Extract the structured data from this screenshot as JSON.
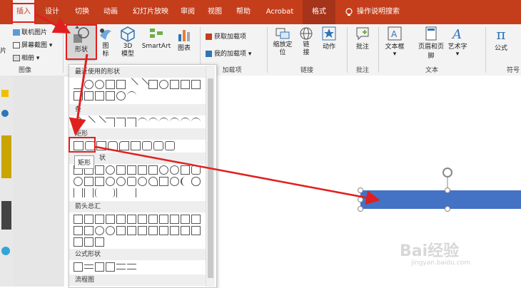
{
  "tabs": [
    "插入",
    "设计",
    "切换",
    "动画",
    "幻灯片放映",
    "审阅",
    "视图",
    "帮助",
    "Acrobat",
    "格式",
    "操作说明搜索"
  ],
  "ribbon": {
    "images_group": {
      "online": "联机图片",
      "screenshot": "屏幕截图",
      "album": "相册",
      "label": "图像",
      "partial_left": "片"
    },
    "shapes_btn": "形状",
    "icons_btn": "图标",
    "model3d_btn": "3D 模型",
    "smartart_btn": "SmartArt",
    "chart_btn": "图表",
    "addins": {
      "get": "获取加载项",
      "mine": "我的加载项",
      "label": "加载项"
    },
    "links": {
      "zoom": "缩放定位",
      "link": "链接",
      "action": "动作",
      "label": "链接"
    },
    "comments": {
      "comment": "批注",
      "label": "批注"
    },
    "text": {
      "textbox": "文本框",
      "header": "页眉和页脚",
      "wordart": "艺术字",
      "label": "文本"
    },
    "symbols": {
      "formula": "公式",
      "label": "符号"
    }
  },
  "gallery": {
    "recent": "最近使用的形状",
    "lines": "线条",
    "lines_partial": "条",
    "rect": "矩形",
    "basic": "基本形状",
    "basic_partial": "状",
    "arrows": "箭头总汇",
    "formula": "公式形状",
    "flow_partial": "流程图"
  },
  "tooltip": "矩形",
  "watermark": {
    "main": "Bai经验",
    "sub": "jingyan.baidu.com"
  },
  "colors": {
    "accent": "#c43e1c",
    "highlight": "#e0201e",
    "shape_fill": "#4472c4"
  }
}
